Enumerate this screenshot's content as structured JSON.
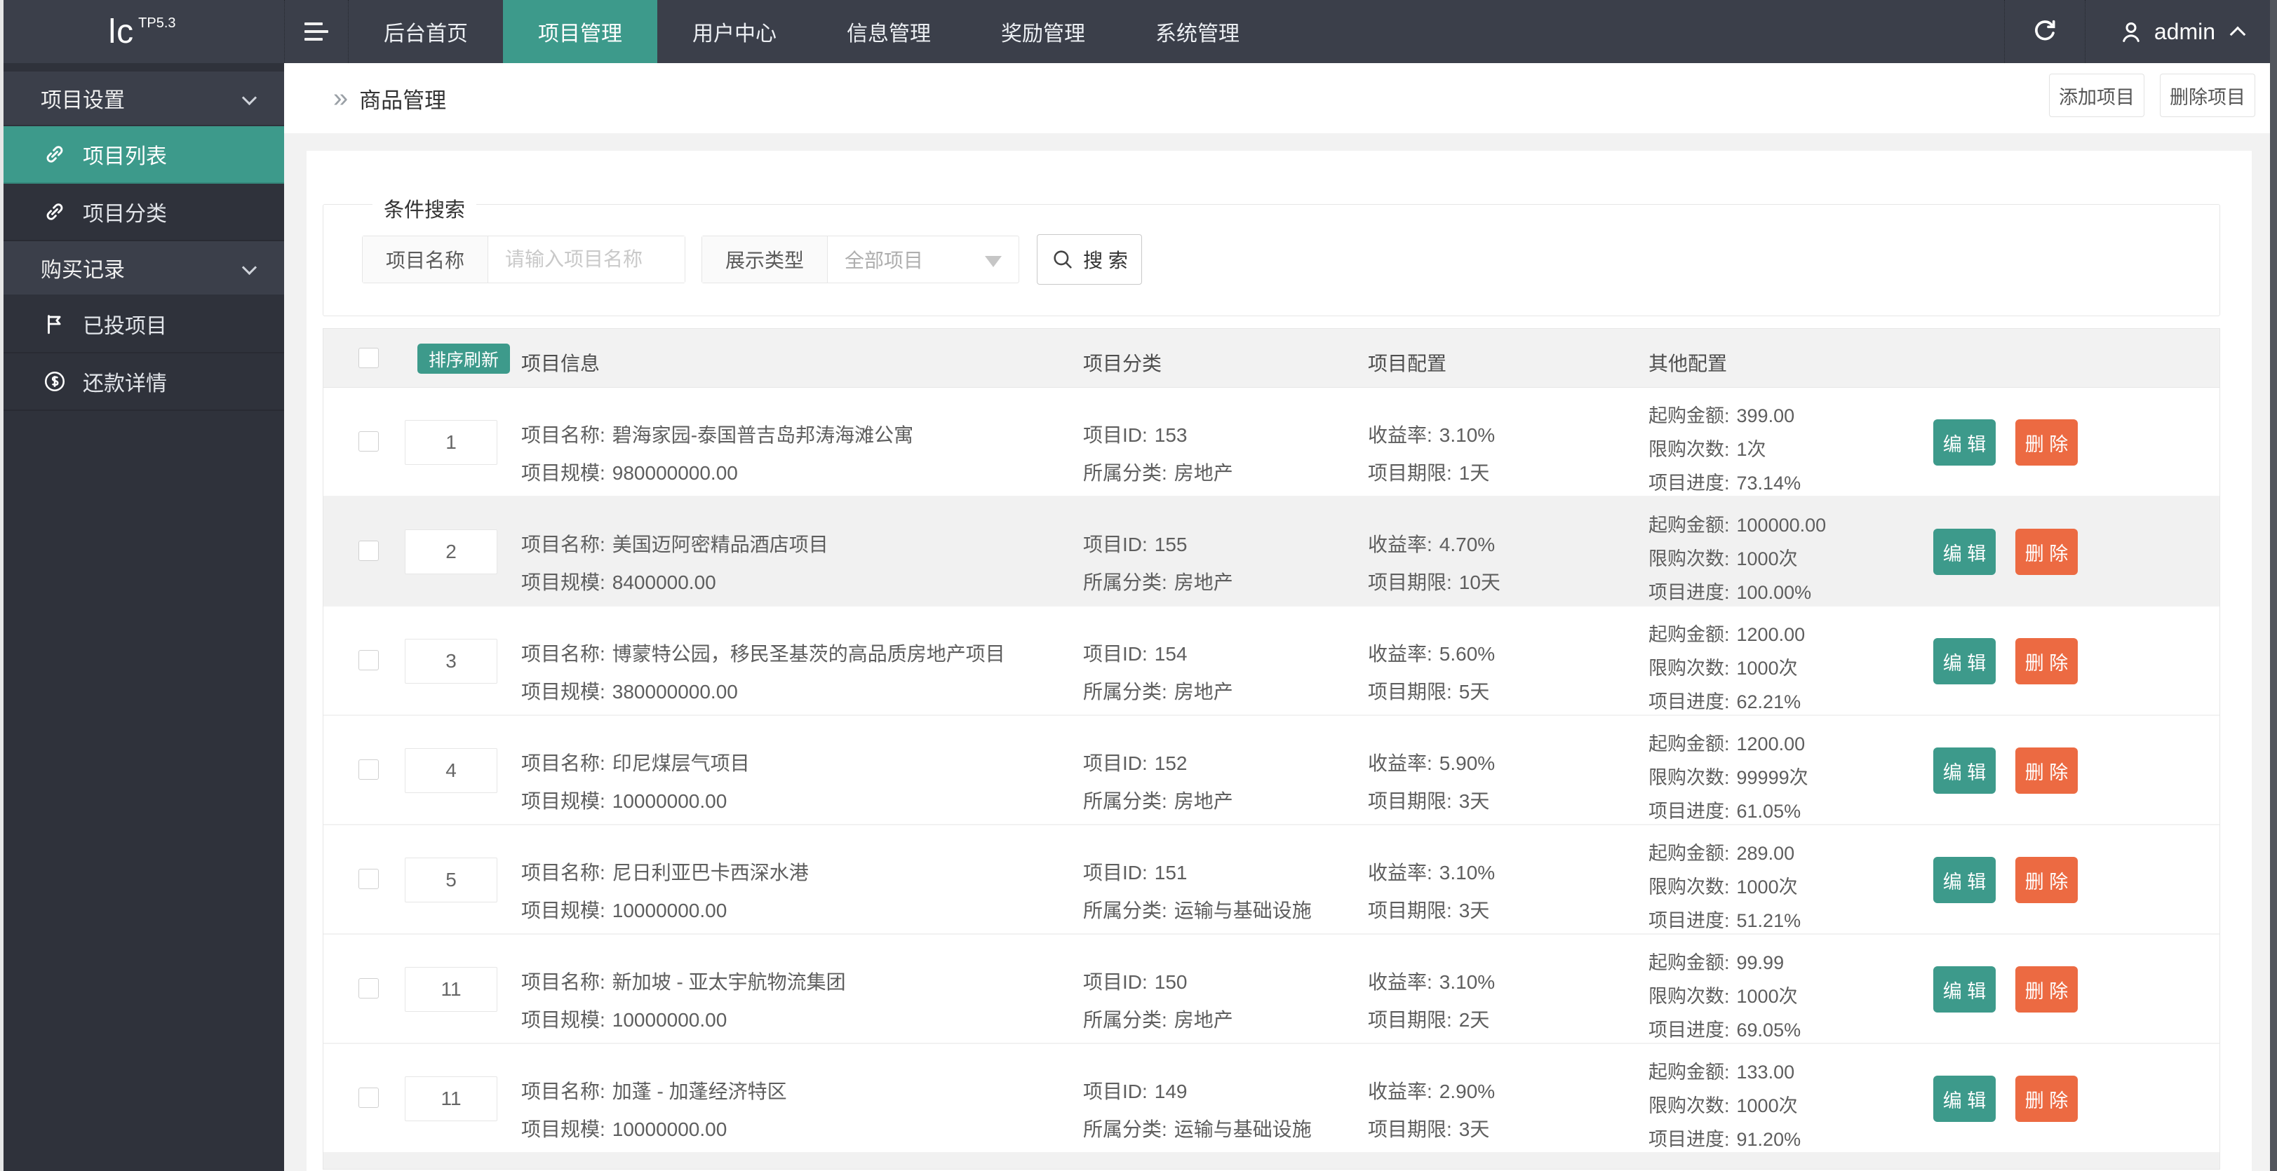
{
  "topbar": {
    "logo": "lc",
    "logo_sup": "TP5.3",
    "tabs": [
      {
        "label": "后台首页",
        "active": false
      },
      {
        "label": "项目管理",
        "active": true
      },
      {
        "label": "用户中心",
        "active": false
      },
      {
        "label": "信息管理",
        "active": false
      },
      {
        "label": "奖励管理",
        "active": false
      },
      {
        "label": "系统管理",
        "active": false
      }
    ],
    "username": "admin"
  },
  "sidebar": {
    "groups": [
      {
        "label": "项目设置",
        "items": [
          {
            "label": "项目列表",
            "icon": "link",
            "active": true
          },
          {
            "label": "项目分类",
            "icon": "link",
            "active": false
          }
        ]
      },
      {
        "label": "购买记录",
        "items": [
          {
            "label": "已投项目",
            "icon": "flag",
            "active": false
          },
          {
            "label": "还款详情",
            "icon": "dollar",
            "active": false
          }
        ]
      }
    ]
  },
  "breadcrumb": {
    "arrow": "»",
    "title": "商品管理"
  },
  "page_actions": {
    "add": "添加项目",
    "delete": "删除项目"
  },
  "search": {
    "legend": "条件搜索",
    "name_label": "项目名称",
    "name_placeholder": "请输入项目名称",
    "type_label": "展示类型",
    "type_value": "全部项目",
    "button": "搜 索"
  },
  "table": {
    "sort_badge": "排序刷新",
    "headers": {
      "info": "项目信息",
      "category": "项目分类",
      "config": "项目配置",
      "other": "其他配置"
    },
    "labels": {
      "name": "项目名称:",
      "scale": "项目规模:",
      "id": "项目ID:",
      "cat": "所属分类:",
      "rate": "收益率:",
      "period": "项目期限:",
      "min": "起购金额:",
      "limit": "限购次数:",
      "progress": "项目进度:"
    },
    "edit_label": "编 辑",
    "delete_label": "删 除",
    "rows": [
      {
        "sort": "1",
        "name": "碧海家园-泰国普吉岛邦涛海滩公寓",
        "scale": "980000000.00",
        "id": "153",
        "category": "房地产",
        "rate": "3.10%",
        "period": "1天",
        "min": "399.00",
        "limit": "1次",
        "progress": "73.14%",
        "highlight": false
      },
      {
        "sort": "2",
        "name": "美国迈阿密精品酒店项目",
        "scale": "8400000.00",
        "id": "155",
        "category": "房地产",
        "rate": "4.70%",
        "period": "10天",
        "min": "100000.00",
        "limit": "1000次",
        "progress": "100.00%",
        "highlight": true
      },
      {
        "sort": "3",
        "name": "博蒙特公园，移民圣基茨的高品质房地产项目",
        "scale": "380000000.00",
        "id": "154",
        "category": "房地产",
        "rate": "5.60%",
        "period": "5天",
        "min": "1200.00",
        "limit": "1000次",
        "progress": "62.21%",
        "highlight": false
      },
      {
        "sort": "4",
        "name": "印尼煤层气项目",
        "scale": "10000000.00",
        "id": "152",
        "category": "房地产",
        "rate": "5.90%",
        "period": "3天",
        "min": "1200.00",
        "limit": "99999次",
        "progress": "61.05%",
        "highlight": false
      },
      {
        "sort": "5",
        "name": "尼日利亚巴卡西深水港",
        "scale": "10000000.00",
        "id": "151",
        "category": "运输与基础设施",
        "rate": "3.10%",
        "period": "3天",
        "min": "289.00",
        "limit": "1000次",
        "progress": "51.21%",
        "highlight": false
      },
      {
        "sort": "11",
        "name": "新加坡 - 亚太宇航物流集团",
        "scale": "10000000.00",
        "id": "150",
        "category": "房地产",
        "rate": "3.10%",
        "period": "2天",
        "min": "99.99",
        "limit": "1000次",
        "progress": "69.05%",
        "highlight": false
      },
      {
        "sort": "11",
        "name": "加蓬 - 加蓬经济特区",
        "scale": "10000000.00",
        "id": "149",
        "category": "运输与基础设施",
        "rate": "2.90%",
        "period": "3天",
        "min": "133.00",
        "limit": "1000次",
        "progress": "91.20%",
        "highlight": false
      }
    ]
  },
  "colors": {
    "accent": "#3D9A8B",
    "danger": "#EC6A42",
    "topbar": "#3B3F4A",
    "sidebar": "#2F323B",
    "page_bg": "#F2F2F2"
  }
}
